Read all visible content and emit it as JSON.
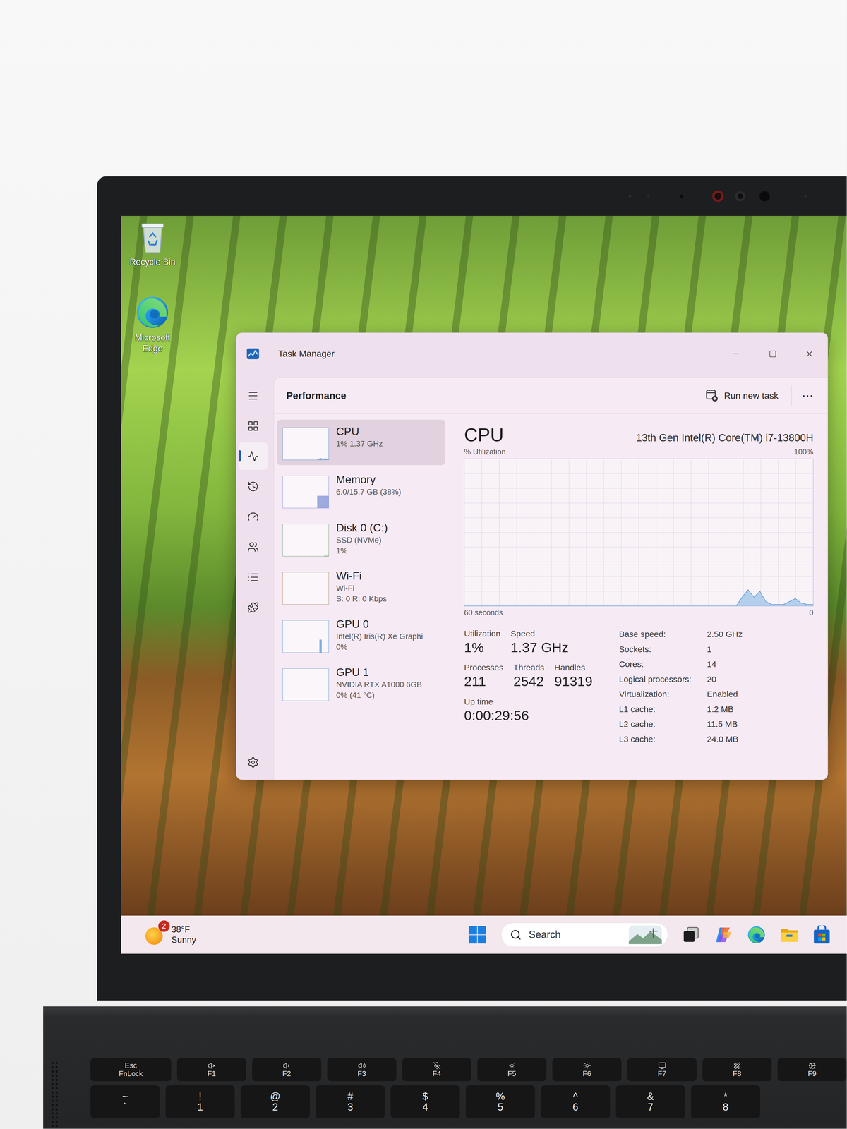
{
  "desktop_icons": [
    {
      "label": "Recycle Bin"
    },
    {
      "label": "Microsoft Edge"
    }
  ],
  "window": {
    "title": "Task Manager"
  },
  "nav": [
    {
      "selected": false
    },
    {
      "selected": true
    },
    {
      "selected": false
    },
    {
      "selected": false
    },
    {
      "selected": false
    },
    {
      "selected": false
    },
    {
      "selected": false
    }
  ],
  "header": {
    "title": "Performance",
    "run_new_task": "Run new task",
    "more": "⋯"
  },
  "devices": [
    {
      "name": "CPU",
      "lines": [
        "1% 1.37 GHz"
      ],
      "selected": true,
      "color": "#5b93cf",
      "values": [
        0,
        0,
        0,
        0,
        0,
        0,
        0,
        0,
        0,
        0,
        0,
        0,
        0,
        0,
        0,
        2,
        5,
        1,
        4,
        2
      ]
    },
    {
      "name": "Memory",
      "lines": [
        "6.0/15.7 GB (38%)"
      ],
      "selected": false,
      "color": "#7f8fd6",
      "values": [
        0,
        0,
        0,
        0,
        0,
        0,
        0,
        0,
        0,
        0,
        0,
        0,
        0,
        0,
        0,
        38,
        38,
        38,
        38,
        38
      ]
    },
    {
      "name": "Disk 0 (C:)",
      "lines": [
        "SSD (NVMe)",
        "1%"
      ],
      "selected": false,
      "color": "#6a9e78",
      "values": [
        0,
        0,
        0,
        0,
        0,
        0,
        0,
        0,
        0,
        0,
        0,
        0,
        0,
        0,
        0,
        0,
        0,
        0,
        1,
        1
      ]
    },
    {
      "name": "Wi-Fi",
      "lines": [
        "Wi-Fi",
        "S: 0 R: 0 Kbps"
      ],
      "selected": false,
      "color": "#a9865f",
      "values": [
        0,
        0,
        0,
        0,
        0,
        0,
        0,
        0,
        0,
        0,
        0,
        0,
        0,
        0,
        0,
        0,
        0,
        0,
        0,
        0
      ]
    },
    {
      "name": "GPU 0",
      "lines": [
        "Intel(R) Iris(R) Xe Graphi",
        "0%"
      ],
      "selected": false,
      "color": "#5b93cf",
      "values": [
        0,
        0,
        0,
        0,
        0,
        0,
        0,
        0,
        0,
        0,
        0,
        0,
        0,
        0,
        0,
        0,
        40,
        0,
        0,
        0
      ]
    },
    {
      "name": "GPU 1",
      "lines": [
        "NVIDIA RTX A1000 6GB",
        "0% (41 °C)"
      ],
      "selected": false,
      "color": "#5b93cf",
      "values": [
        0,
        0,
        0,
        0,
        0,
        0,
        0,
        0,
        0,
        0,
        0,
        0,
        0,
        0,
        0,
        0,
        0,
        0,
        0,
        0
      ]
    }
  ],
  "detail": {
    "title": "CPU",
    "model": "13th Gen Intel(R) Core(TM) i7-13800H",
    "chart": {
      "y_label": "% Utilization",
      "y_max": "100%",
      "x_label": "60 seconds",
      "x_end": "0",
      "max": 100,
      "values": [
        0,
        0,
        0,
        0,
        0,
        0,
        0,
        0,
        0,
        0,
        0,
        0,
        0,
        0,
        0,
        0,
        0,
        0,
        0,
        0,
        0,
        0,
        0,
        0,
        0,
        0,
        0,
        0,
        0,
        0,
        0,
        0,
        0,
        0,
        0,
        0,
        0,
        0,
        0,
        0,
        0,
        0,
        0,
        0,
        0,
        0,
        0,
        6,
        11,
        6,
        10,
        3,
        1,
        1,
        1,
        3,
        5,
        2,
        1,
        1
      ]
    },
    "stats": [
      [
        {
          "label": "Utilization",
          "value": "1%"
        },
        {
          "label": "Speed",
          "value": "1.37 GHz"
        }
      ],
      [
        {
          "label": "Processes",
          "value": "211"
        },
        {
          "label": "Threads",
          "value": "2542"
        },
        {
          "label": "Handles",
          "value": "91319"
        }
      ],
      [
        {
          "label": "Up time",
          "value": "0:00:29:56"
        }
      ]
    ],
    "specs": [
      {
        "label": "Base speed:",
        "value": "2.50 GHz"
      },
      {
        "label": "Sockets:",
        "value": "1"
      },
      {
        "label": "Cores:",
        "value": "14"
      },
      {
        "label": "Logical processors:",
        "value": "20"
      },
      {
        "label": "Virtualization:",
        "value": "Enabled"
      },
      {
        "label": "L1 cache:",
        "value": "1.2 MB"
      },
      {
        "label": "L2 cache:",
        "value": "11.5 MB"
      },
      {
        "label": "L3 cache:",
        "value": "24.0 MB"
      }
    ]
  },
  "taskbar": {
    "weather": {
      "badge": "2",
      "temperature": "38°F",
      "condition": "Sunny"
    },
    "search": {
      "placeholder": "Search"
    }
  },
  "keyboard": {
    "function_row": [
      {
        "label": "Esc",
        "sub": "FnLock"
      },
      {
        "label": "F1"
      },
      {
        "label": "F2"
      },
      {
        "label": "F3"
      },
      {
        "label": "F4"
      },
      {
        "label": "F5"
      },
      {
        "label": "F6"
      },
      {
        "label": "F7"
      },
      {
        "label": "F8"
      },
      {
        "label": "F9"
      }
    ],
    "number_row": [
      {
        "top": "~",
        "bottom": "`"
      },
      {
        "top": "!",
        "bottom": "1"
      },
      {
        "top": "@",
        "bottom": "2"
      },
      {
        "top": "#",
        "bottom": "3"
      },
      {
        "top": "$",
        "bottom": "4"
      },
      {
        "top": "%",
        "bottom": "5"
      },
      {
        "top": "^",
        "bottom": "6"
      },
      {
        "top": "&",
        "bottom": "7"
      },
      {
        "top": "*",
        "bottom": "8"
      }
    ]
  }
}
